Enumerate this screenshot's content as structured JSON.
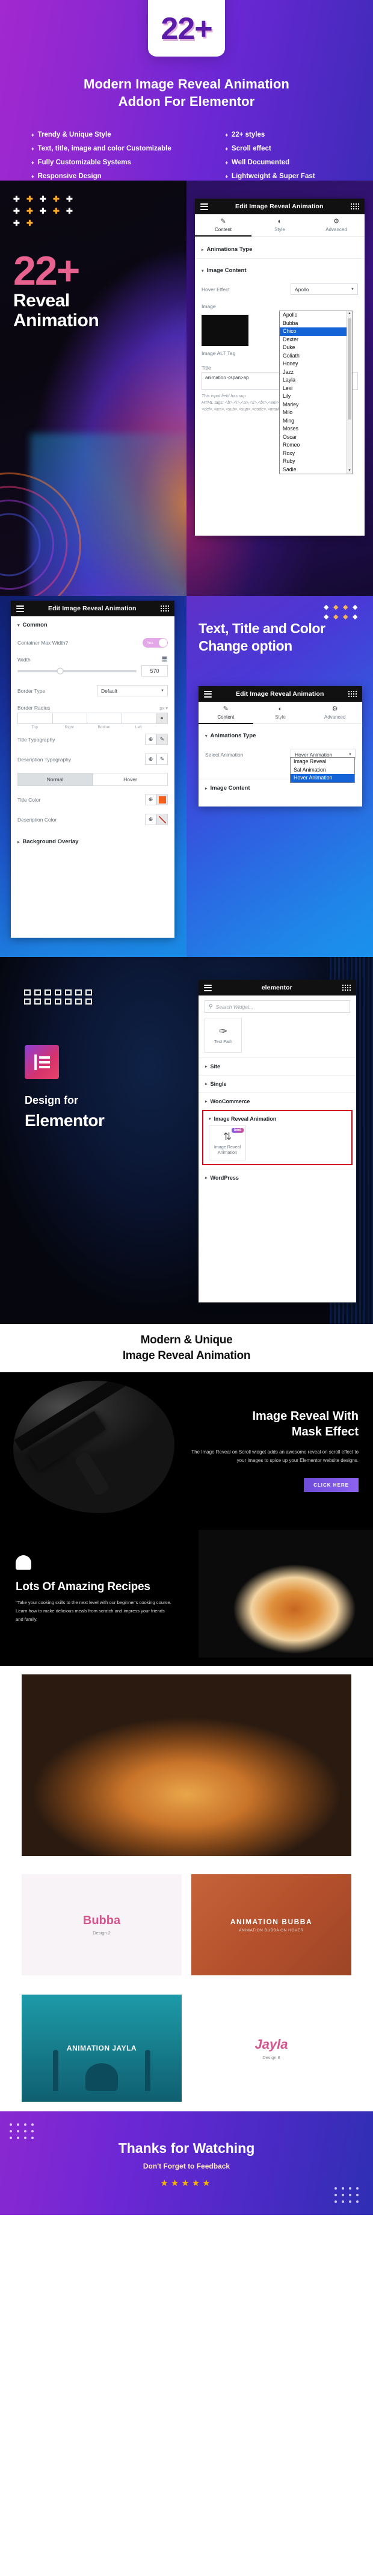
{
  "hero": {
    "badge": "22+",
    "title_line1": "Modern Image Reveal Animation",
    "title_line2": "Addon For Elementor",
    "bullet": "♦",
    "features_left": [
      "Trendy & Unique Style",
      "Text, title, image and color Customizable",
      "Fully Customizable Systems",
      "Responsive Design"
    ],
    "features_right": [
      "22+ styles",
      "Scroll effect",
      "Well Documented",
      "Lightweight & Super Fast"
    ]
  },
  "section_reveal": {
    "count": "22+",
    "line1": "Reveal",
    "line2": "Animation",
    "plus_glyph": "✚"
  },
  "panel_common": {
    "title": "Edit Image Reveal Animation",
    "tabs": [
      {
        "label": "Content",
        "icon": "✎"
      },
      {
        "label": "Style",
        "icon": "◐"
      },
      {
        "label": "Advanced",
        "icon": "⚙"
      }
    ],
    "active_tab": "Content"
  },
  "panel_hover_effect": {
    "animations_type_label": "Animations Type",
    "image_content_label": "Image Content",
    "hover_effect_label": "Hover Effect",
    "hover_effect_value": "Apollo",
    "image_label": "Image",
    "image_alt_tag_label": "Image ALT Tag",
    "title_label": "Title",
    "title_value": "animation <span>ap",
    "hint_line1": "This input field has sup",
    "hint_line2": "HTML tags: <b>,<i>,<a>,<s>,<br>,<em>,",
    "hint_line3": "<del>,<ins>,<sub>,<sup>,<code>,<mark>,",
    "dropdown_options": [
      "Apollo",
      "Bubba",
      "Chico",
      "Dexter",
      "Duke",
      "Goliath",
      "Honey",
      "Jazz",
      "Layla",
      "Lexi",
      "Lily",
      "Marley",
      "Milo",
      "Ming",
      "Moses",
      "Oscar",
      "Romeo",
      "Roxy",
      "Ruby",
      "Sadie"
    ],
    "dropdown_selected": "Chico",
    "scroll_up_glyph": "▲",
    "scroll_down_glyph": "▼"
  },
  "section_text_title": {
    "heading_line1": "Text, Title and Color",
    "heading_line2": "Change option",
    "diamond": "◆"
  },
  "panel_common_style": {
    "title": "Edit Image Reveal Animation",
    "common_label": "Common",
    "container_max_width_label": "Container Max Width?",
    "toggle_value": "Yes",
    "width_label": "Width",
    "width_value": "570",
    "border_type_label": "Border Type",
    "border_type_value": "Default",
    "border_radius_label": "Border Radius",
    "unit": "px",
    "dim_labels": [
      "Top",
      "Right",
      "Bottom",
      "Left"
    ],
    "title_typography_label": "Title Typography",
    "description_typography_label": "Description Typography",
    "normal_label": "Normal",
    "hover_label": "Hover",
    "title_color_label": "Title Color",
    "title_color_value": "#F4601C",
    "description_color_label": "Description Color",
    "background_overlay_label": "Background Overlay",
    "globe_icon": "⊕",
    "pencil_icon": "✎",
    "link_icon": "⚭"
  },
  "panel_select_animation": {
    "animations_type_label": "Animations Type",
    "select_animation_label": "Select Animation",
    "select_animation_value": "Hover Animation",
    "image_content_label": "Image Content",
    "options": [
      "Image Reveal",
      "Sal Animation",
      "Hover Animation"
    ],
    "selected": "Hover Animation"
  },
  "section_design_for": {
    "line1": "Design for",
    "line2": "Elementor"
  },
  "widget_panel": {
    "title": "elementor",
    "search_placeholder": "Search Widget...",
    "search_icon": "⚲",
    "widget_text_path": {
      "label": "Text Path",
      "icon": "✑"
    },
    "groups": [
      "Site",
      "Single",
      "WooCommerce"
    ],
    "highlight_group": "Image Reveal Animation",
    "highlight_widget": {
      "label": "Image Reveal Animation",
      "icon": "⇅",
      "badge": "bwd"
    },
    "last_group": "WordPress"
  },
  "section_modern": {
    "line1": "Modern & Unique",
    "line2": "Image Reveal Animation"
  },
  "section_mask": {
    "heading_line1": "Image Reveal With",
    "heading_line2": "Mask Effect",
    "paragraph": "The Image Reveal on Scroll widget adds an awesome reveal on scroll effect to your images to spice up your Elementor website designs.",
    "button": "CLICK HERE"
  },
  "section_recipes": {
    "heading": "Lots Of Amazing Recipes",
    "paragraph": "\"Take your cooking skills to the next level with our beginner's cooking course. Learn how to make delicious meals from scratch and impress your friends and family."
  },
  "cards_row_1": [
    {
      "title": "Bubba",
      "subtitle": "Design 2",
      "style": "light"
    },
    {
      "title": "ANIMATION BUBBA",
      "subtitle": "ANIMATION BUBBA ON HOVER",
      "style": "orange"
    }
  ],
  "cards_row_2": [
    {
      "title": "ANIMATION JAYLA",
      "subtitle": "",
      "style": "teal"
    },
    {
      "title": "Jayla",
      "subtitle": "Design 8",
      "style": "light"
    }
  ],
  "footer": {
    "title": "Thanks for Watching",
    "subtitle": "Don't Forget to Feedback",
    "stars": "★★★★★"
  },
  "colors": {
    "brand_purple": "#6b27d4",
    "brand_magenta": "#a328cf",
    "pink_accent": "#e8628f",
    "orange_accent": "#f5a623",
    "highlight_red": "#d0021b",
    "dropdown_blue": "#1464d7"
  }
}
